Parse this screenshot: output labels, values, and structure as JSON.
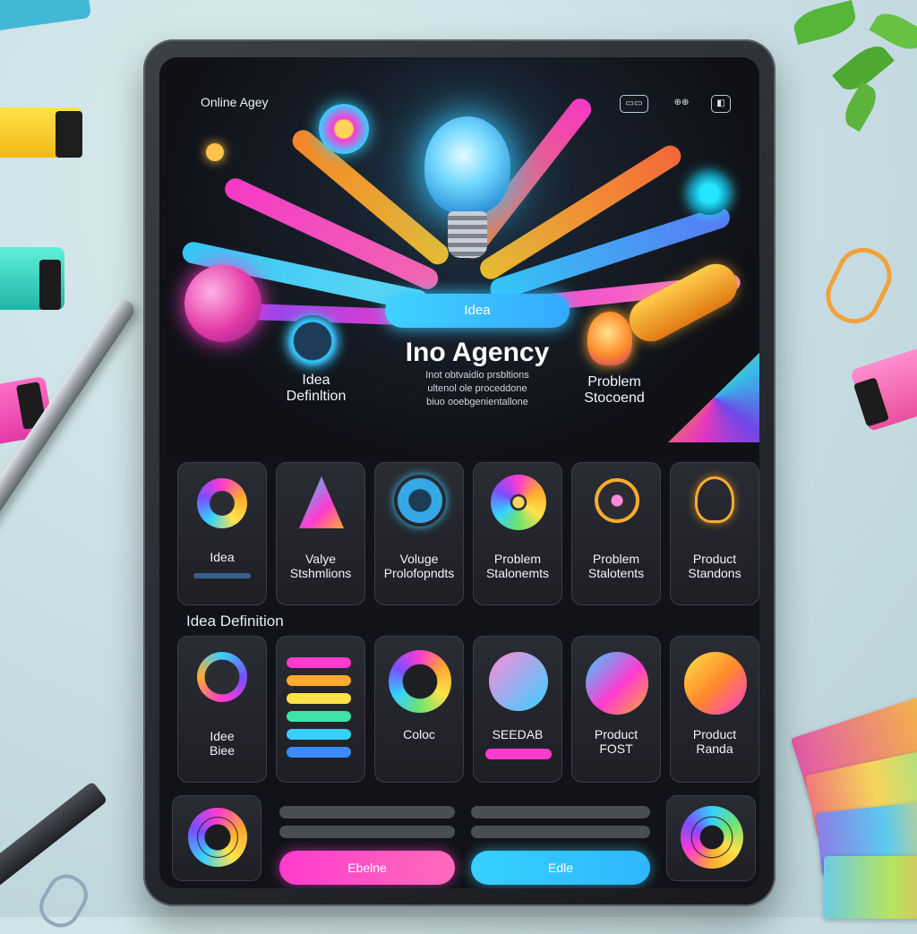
{
  "topbar": {
    "brand": "Online Agey",
    "buttons": [
      "▭▭",
      "⊕⊕",
      "◧"
    ]
  },
  "hero": {
    "pill_label": "Idea",
    "title": "Ino Agency",
    "description": "Inot obtvaidio prsbltions\nultenol ole proceddone\nbiuo ooebgenientallone",
    "left_label": "Idea\nDefinltion",
    "right_label": "Problem\nStocoend"
  },
  "row1": [
    {
      "label": "Idea",
      "sub": "",
      "icon": "donut-icon"
    },
    {
      "label": "Valye\nStshmlions",
      "sub": "",
      "icon": "triangle-icon"
    },
    {
      "label": "Voluge\nProlofopndts",
      "sub": "",
      "icon": "gear-icon"
    },
    {
      "label": "Problem\nStalonemts",
      "sub": "",
      "icon": "flower-icon"
    },
    {
      "label": "Problem\nStalotents",
      "sub": "",
      "icon": "bug-icon"
    },
    {
      "label": "Product\nStandons",
      "sub": "",
      "icon": "lightbulb-icon"
    }
  ],
  "section_title": "Idea Definition",
  "row2": [
    {
      "label": "Idee\nBiee",
      "icon": "ring-icon"
    },
    {
      "label": "",
      "icon": "list-icon"
    },
    {
      "label": "Coloc",
      "icon": "color-wheel-icon"
    },
    {
      "label": "SEEDAB",
      "icon": "gradient-sphere-icon"
    },
    {
      "label": "Product\nFOST",
      "icon": "gradient-sphere-icon"
    },
    {
      "label": "Product\nRanda",
      "icon": "gradient-sphere-icon"
    }
  ],
  "footer": {
    "left_button": "Ebelne",
    "right_button": "Edle"
  },
  "colors": {
    "cyan": "#37c6ff",
    "magenta": "#ff3bd0",
    "orange": "#ffab2e",
    "screen_bg": "#121318"
  }
}
